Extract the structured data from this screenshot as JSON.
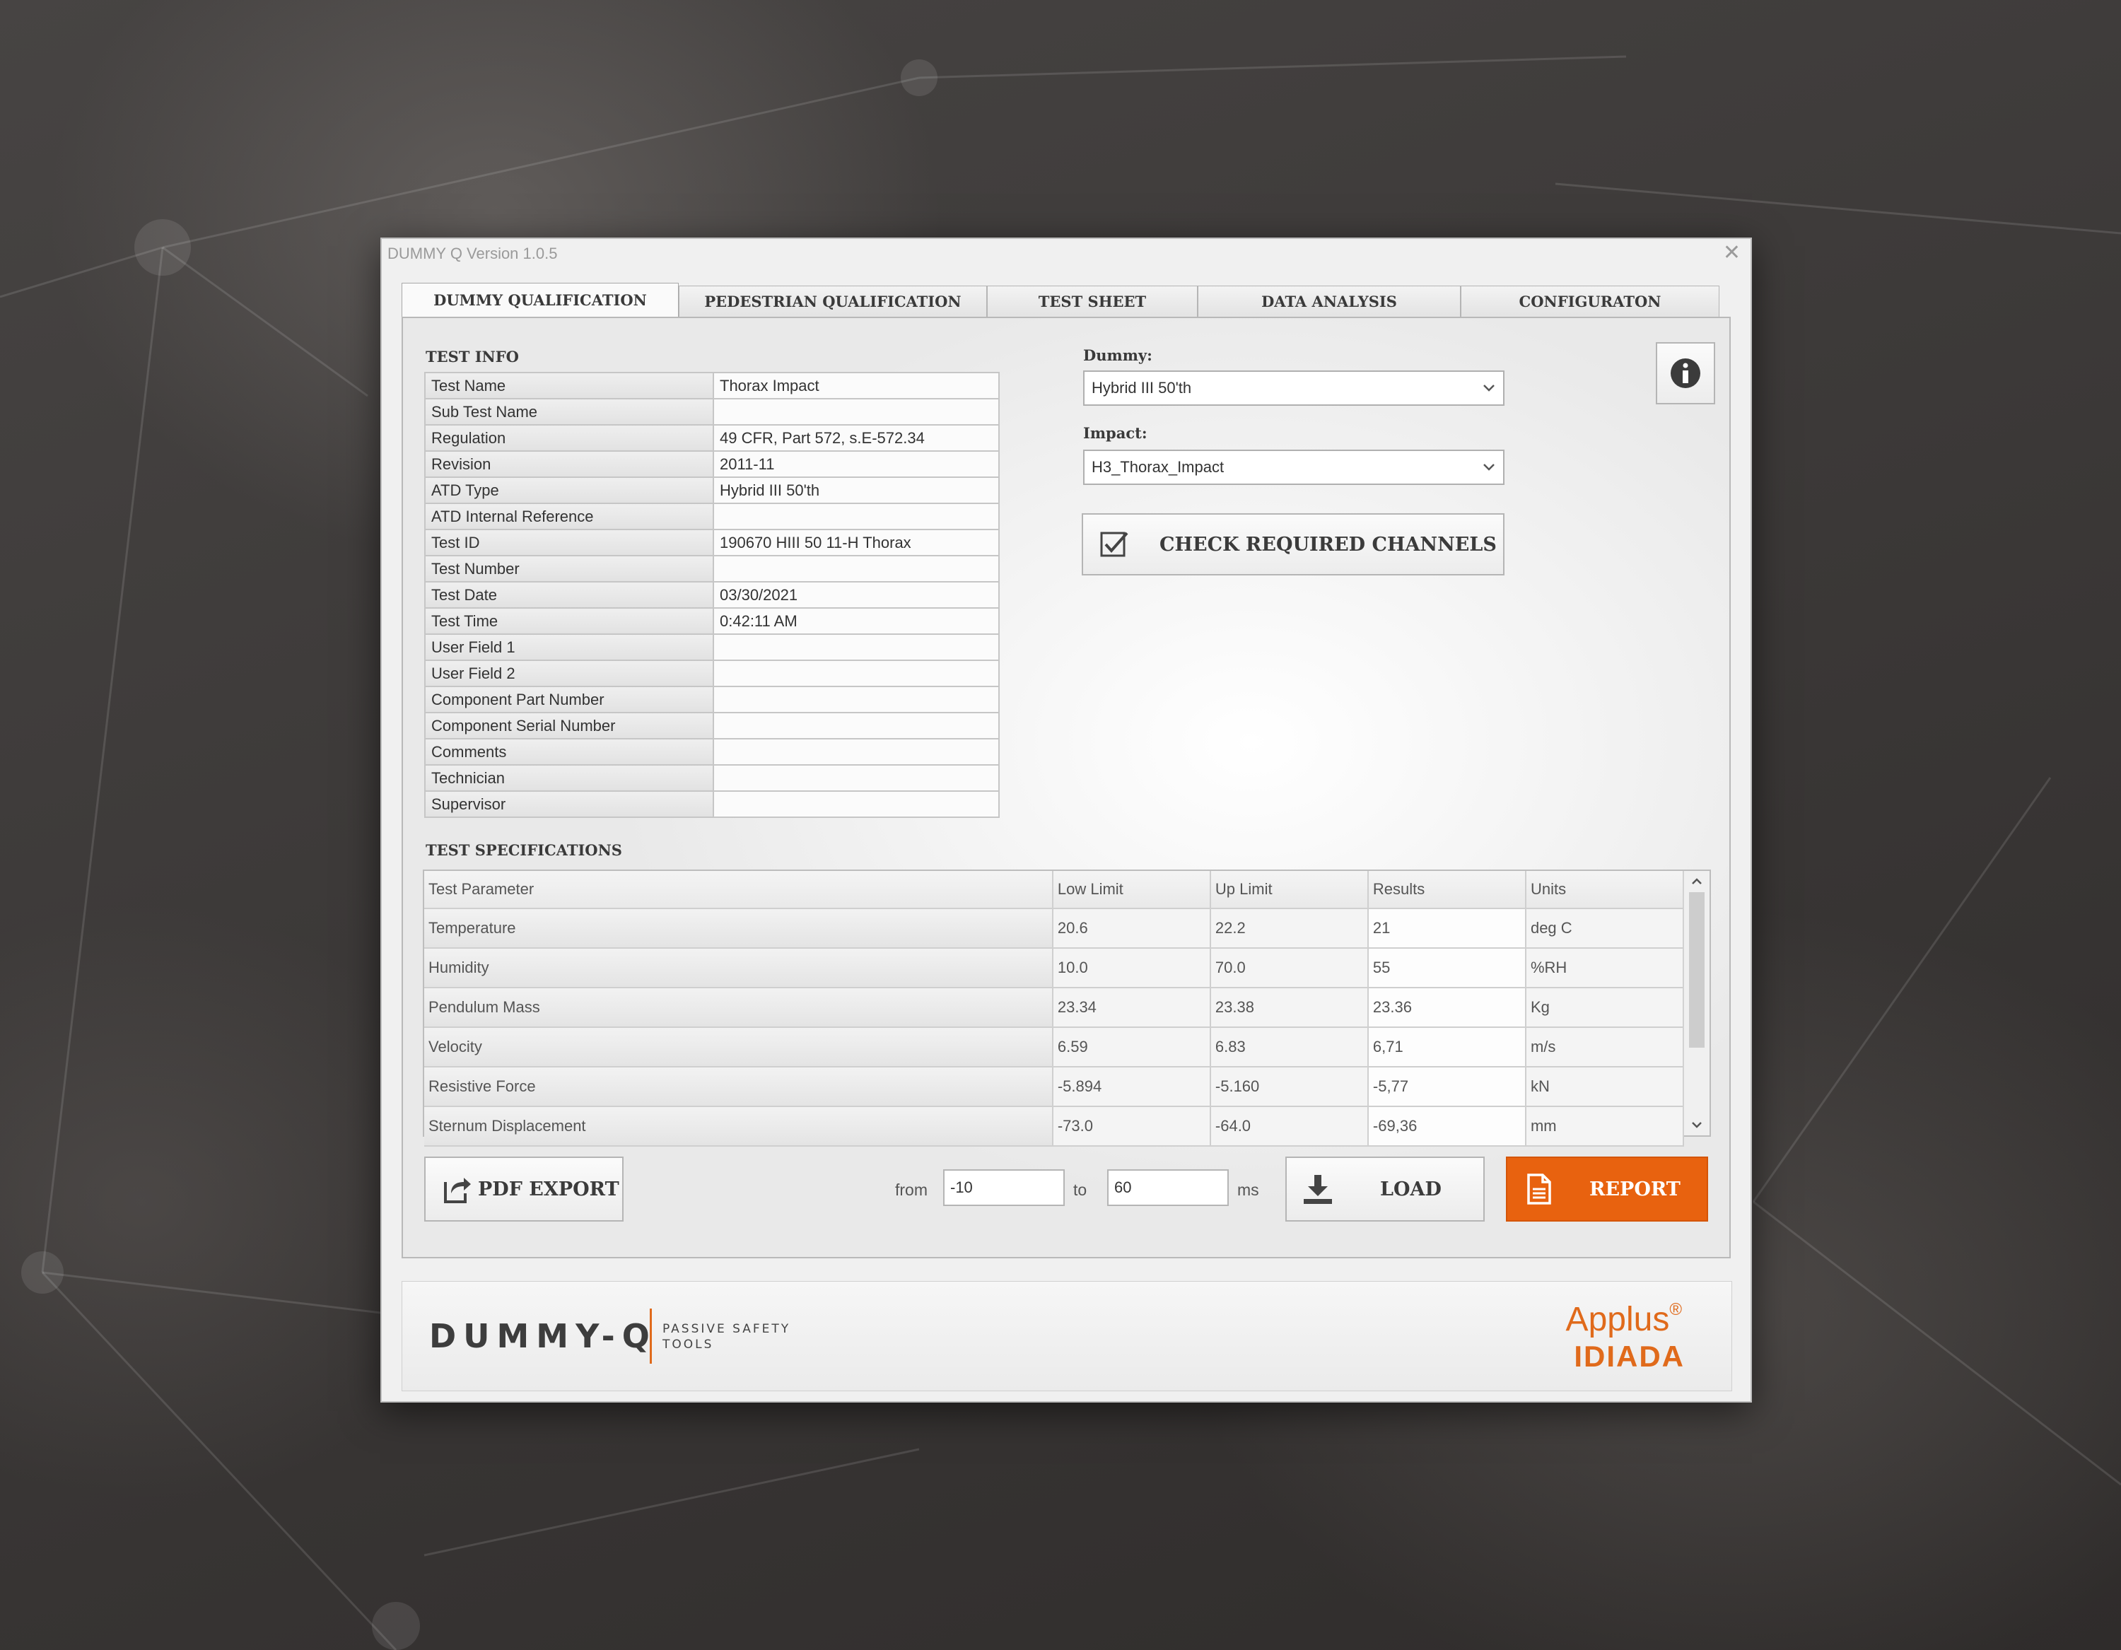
{
  "window": {
    "title": "DUMMY Q  Version 1.0.5",
    "close_glyph": "✕"
  },
  "tabs": [
    {
      "label": "DUMMY QUALIFICATION",
      "active": true
    },
    {
      "label": "PEDESTRIAN QUALIFICATION"
    },
    {
      "label": "TEST SHEET"
    },
    {
      "label": "DATA ANALYSIS"
    },
    {
      "label": "CONFIGURATON"
    }
  ],
  "test_info": {
    "title": "TEST INFO",
    "rows": [
      {
        "label": "Test Name",
        "value": "Thorax Impact"
      },
      {
        "label": "Sub Test Name",
        "value": ""
      },
      {
        "label": "Regulation",
        "value": "49 CFR, Part 572, s.E-572.34"
      },
      {
        "label": "Revision",
        "value": "2011-11"
      },
      {
        "label": "ATD Type",
        "value": "Hybrid III 50'th"
      },
      {
        "label": "ATD Internal Reference",
        "value": ""
      },
      {
        "label": "Test ID",
        "value": "190670 HIII 50 11-H Thorax"
      },
      {
        "label": "Test Number",
        "value": ""
      },
      {
        "label": "Test Date",
        "value": "03/30/2021"
      },
      {
        "label": "Test Time",
        "value": "0:42:11 AM"
      },
      {
        "label": "User Field 1",
        "value": ""
      },
      {
        "label": "User Field 2",
        "value": ""
      },
      {
        "label": "Component Part Number",
        "value": ""
      },
      {
        "label": "Component Serial Number",
        "value": ""
      },
      {
        "label": "Comments",
        "value": ""
      },
      {
        "label": "Technician",
        "value": ""
      },
      {
        "label": "Supervisor",
        "value": ""
      }
    ]
  },
  "dummy": {
    "label": "Dummy:",
    "value": "Hybrid III 50'th"
  },
  "impact": {
    "label": "Impact:",
    "value": "H3_Thorax_Impact"
  },
  "check_button": {
    "label": "CHECK REQUIRED CHANNELS"
  },
  "test_specs": {
    "title": "TEST SPECIFICATIONS",
    "columns": [
      "Test Parameter",
      "Low Limit",
      "Up Limit",
      "Results",
      "Units"
    ],
    "rows": [
      [
        "Temperature",
        "20.6",
        "22.2",
        "21",
        "deg C"
      ],
      [
        "Humidity",
        "10.0",
        "70.0",
        "55",
        "%RH"
      ],
      [
        "Pendulum Mass",
        "23.34",
        "23.38",
        "23.36",
        "Kg"
      ],
      [
        "Velocity",
        "6.59",
        "6.83",
        "6,71",
        "m/s"
      ],
      [
        "Resistive Force",
        "-5.894",
        "-5.160",
        "-5,77",
        "kN"
      ],
      [
        "Sternum Displacement",
        "-73.0",
        "-64.0",
        "-69,36",
        "mm"
      ]
    ]
  },
  "range": {
    "from_label": "from",
    "from_value": "-10",
    "to_label": "to",
    "to_value": "60",
    "unit": "ms"
  },
  "buttons": {
    "pdf_export": "PDF EXPORT",
    "load": "LOAD",
    "report": "REPORT"
  },
  "footer": {
    "brand": "DUMMY-Q",
    "brand_sub": "PASSIVE SAFETY TOOLS",
    "logo_line1": "Applus",
    "logo_reg": "®",
    "logo_line2": "IDIADA"
  },
  "colors": {
    "accent": "#e06a1b",
    "report_bg": "#e8620f"
  }
}
